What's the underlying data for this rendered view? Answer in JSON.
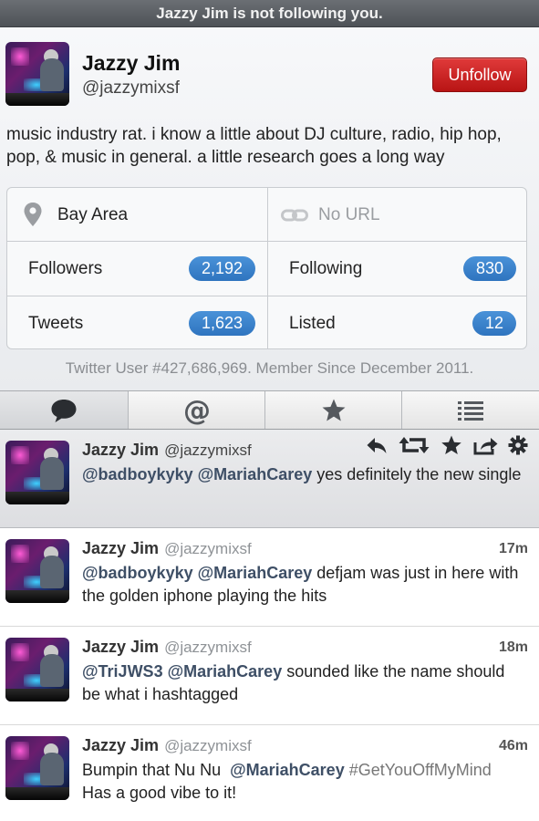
{
  "banner": {
    "text": "Jazzy Jim is not following you."
  },
  "profile": {
    "name": "Jazzy Jim",
    "handle": "@jazzymixsf",
    "unfollow_label": "Unfollow",
    "bio": "music industry rat. i know a little about DJ culture, radio, hip hop, pop, & music in general. a little research goes a long way",
    "location": "Bay Area",
    "url": "No URL",
    "followers_label": "Followers",
    "followers_count": "2,192",
    "following_label": "Following",
    "following_count": "830",
    "tweets_label": "Tweets",
    "tweets_count": "1,623",
    "listed_label": "Listed",
    "listed_count": "12",
    "member_info": "Twitter User #427,686,969. Member Since December 2011."
  },
  "tabs": [
    {
      "icon": "speech-bubble-icon",
      "active": true
    },
    {
      "icon": "at-sign-icon",
      "active": false
    },
    {
      "icon": "star-icon",
      "active": false
    },
    {
      "icon": "list-icon",
      "active": false
    }
  ],
  "tweets": [
    {
      "name": "Jazzy Jim",
      "handle": "@jazzymixsf",
      "time": "",
      "mention1": "@badboykyky",
      "mention2": "@MariahCarey",
      "text": " yes definitely the new single",
      "selected": true
    },
    {
      "name": "Jazzy Jim",
      "handle": "@jazzymixsf",
      "time": "17m",
      "mention1": "@badboykyky",
      "mention2": "@MariahCarey",
      "text": " defjam was just in here with the golden iphone playing the hits"
    },
    {
      "name": "Jazzy Jim",
      "handle": "@jazzymixsf",
      "time": "18m",
      "mention1": "@TriJWS3",
      "mention2": "@MariahCarey",
      "text": " sounded like the name should be what i hashtagged"
    },
    {
      "name": "Jazzy Jim",
      "handle": "@jazzymixsf",
      "time": "46m",
      "prefix": "Bumpin that Nu Nu  ",
      "mention2": "@MariahCarey",
      "hashtag": " #GetYouOffMyMind",
      "text": "Has a good vibe to it!"
    }
  ],
  "colors": {
    "accent_blue": "#2f74bf",
    "unfollow_red": "#c81a1a",
    "mention_color": "#3e4f66"
  }
}
